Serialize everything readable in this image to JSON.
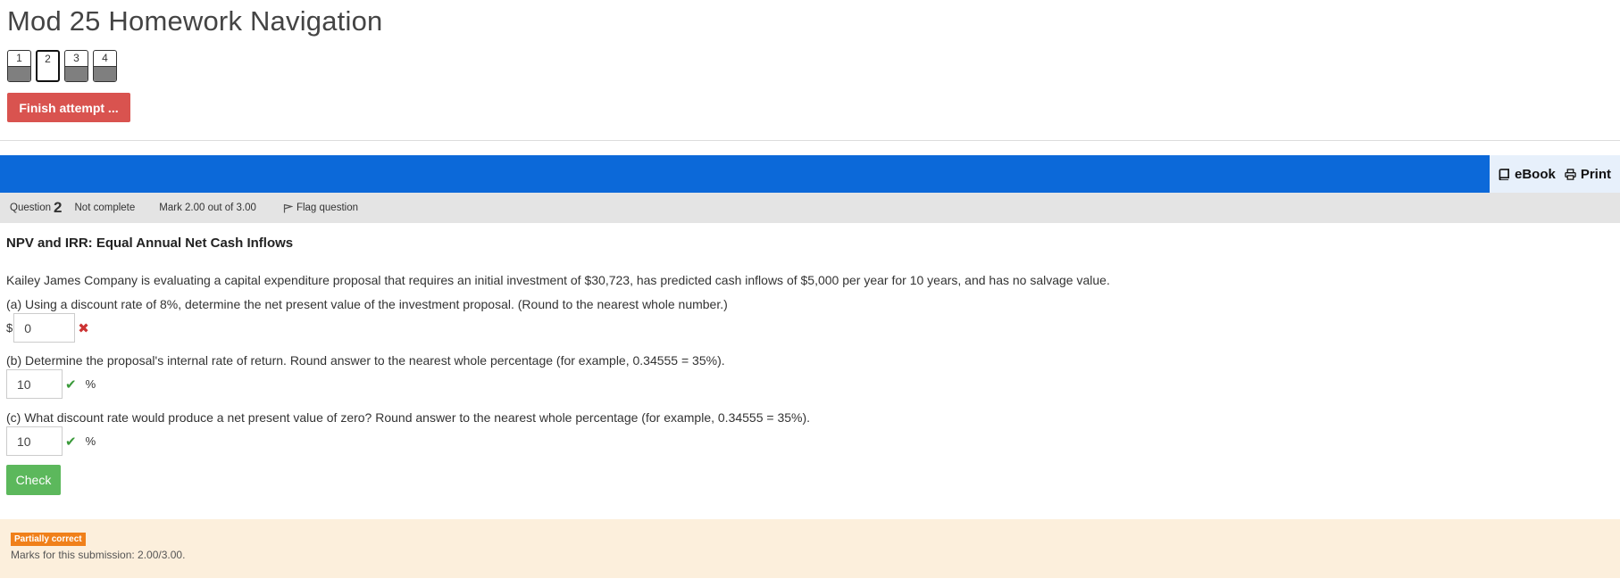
{
  "navigation": {
    "title": "Mod 25 Homework Navigation",
    "questions": [
      {
        "label": "1",
        "current": false
      },
      {
        "label": "2",
        "current": true
      },
      {
        "label": "3",
        "current": false
      },
      {
        "label": "4",
        "current": false
      }
    ],
    "finish_label": "Finish attempt ..."
  },
  "tools": {
    "ebook_label": "eBook",
    "print_label": "Print"
  },
  "question_info": {
    "question_word": "Question",
    "number": "2",
    "state": "Not complete",
    "grade": "Mark 2.00 out of 3.00",
    "flag_label": "Flag question"
  },
  "question": {
    "title": "NPV and IRR: Equal Annual Net Cash Inflows",
    "intro": "Kailey James Company is evaluating a capital expenditure proposal that requires an initial investment of $30,723, has predicted cash inflows of $5,000 per year for 10 years, and has no salvage value.",
    "part_a": "(a) Using a discount rate of 8%, determine the net present value of the investment proposal. (Round to the nearest whole number.)",
    "part_b": "(b) Determine the proposal's internal rate of return. Round answer to the nearest whole percentage (for example, 0.34555 = 35%).",
    "part_c": "(c) What discount rate would produce a net present value of zero? Round answer to the nearest whole percentage (for example, 0.34555 = 35%).",
    "currency_symbol": "$",
    "answer_a": "0",
    "answer_b": "10",
    "answer_c": "10",
    "percent_symbol": "%",
    "check_label": "Check"
  },
  "feedback": {
    "badge": "Partially correct",
    "marks_text": "Marks for this submission: 2.00/3.00."
  },
  "colors": {
    "finish_button": "#d9534f",
    "blue_bar": "#0c69d9",
    "check_button": "#5cb85c",
    "feedback_bg": "#fcefdc",
    "badge": "#f0801a",
    "correct": "#3a9a3a",
    "incorrect": "#cc3333"
  }
}
